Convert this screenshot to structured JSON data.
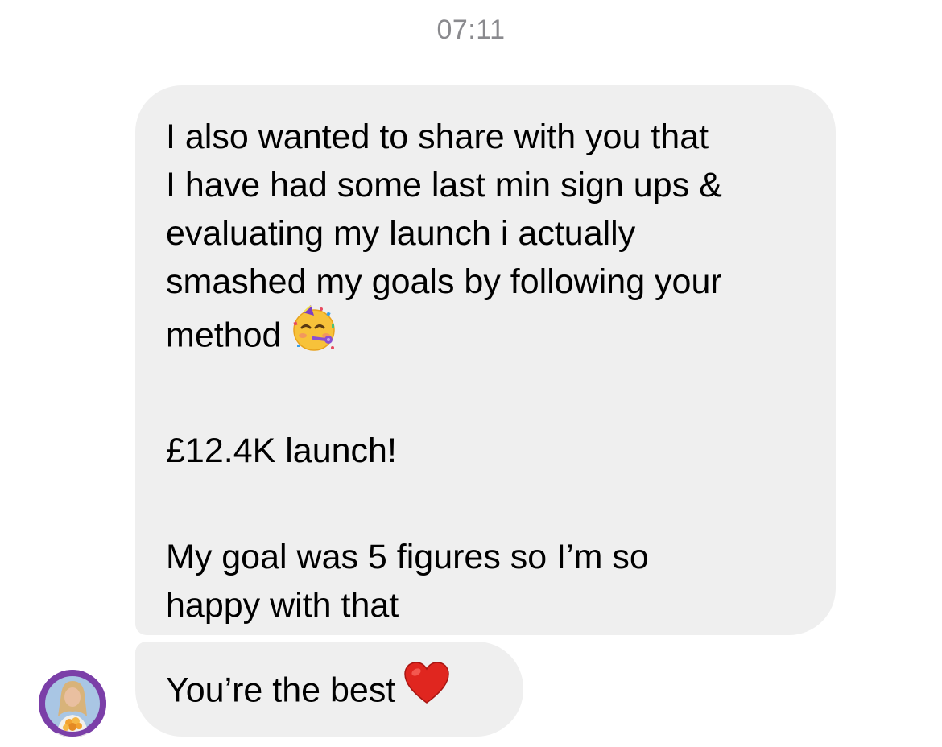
{
  "timestamp": "07:11",
  "message": {
    "line1": "I also wanted to share with you that",
    "line2": "I have had some last min sign ups &",
    "line3": "evaluating my launch i actually",
    "line4": "smashed my goals by following your",
    "line5": "method",
    "line5_emoji": "partying-face-emoji",
    "para2": "£12.4K launch!",
    "para3_line1": "My goal was 5 figures so I’m so",
    "para3_line2": "happy with that"
  },
  "last_message": {
    "text": "You’re the best",
    "emoji": "red-heart-emoji"
  },
  "colors": {
    "bubble": "#efefef",
    "timestamp": "#8a8a8e",
    "avatar_ring": "#7b3fa8",
    "heart": "#e0261f"
  }
}
